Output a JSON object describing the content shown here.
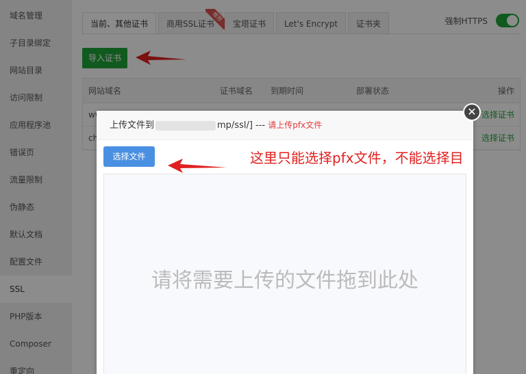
{
  "sidebar": {
    "items": [
      {
        "label": "域名管理"
      },
      {
        "label": "子目录绑定"
      },
      {
        "label": "网站目录"
      },
      {
        "label": "访问限制"
      },
      {
        "label": "应用程序池"
      },
      {
        "label": "错误页"
      },
      {
        "label": "流量限制"
      },
      {
        "label": "伪静态"
      },
      {
        "label": "默认文档"
      },
      {
        "label": "配置文件"
      },
      {
        "label": "SSL",
        "active": true
      },
      {
        "label": "PHP版本"
      },
      {
        "label": "Composer"
      },
      {
        "label": "重定向"
      }
    ]
  },
  "tabs": [
    {
      "label": "当前、其他证书",
      "active": true
    },
    {
      "label": "商用SSL证书",
      "badge": "推荐"
    },
    {
      "label": "宝塔证书"
    },
    {
      "label": "Let's Encrypt"
    },
    {
      "label": "证书夹"
    }
  ],
  "https": {
    "label": "强制HTTPS",
    "enabled": true
  },
  "import_button": "导入证书",
  "table": {
    "headers": [
      "网站域名",
      "证书域名",
      "到期时间",
      "部署状态",
      "操作"
    ],
    "rows": [
      {
        "domain": "ww",
        "action": "选择证书"
      },
      {
        "domain": "ch",
        "action": "选择证书"
      }
    ]
  },
  "dialog": {
    "title_prefix": "上传文件到",
    "title_path": "mp/ssl/]",
    "title_sep": " --- ",
    "title_warning": "请上传pfx文件",
    "choose_button": "选择文件",
    "drop_text": "请将需要上传的文件拖到此处",
    "close_icon": "close-icon"
  },
  "annotation": "这里只能选择pfx文件，不能选择目",
  "colors": {
    "accent": "#20a53a",
    "blue": "#4a90e2",
    "warning": "#e02020"
  }
}
